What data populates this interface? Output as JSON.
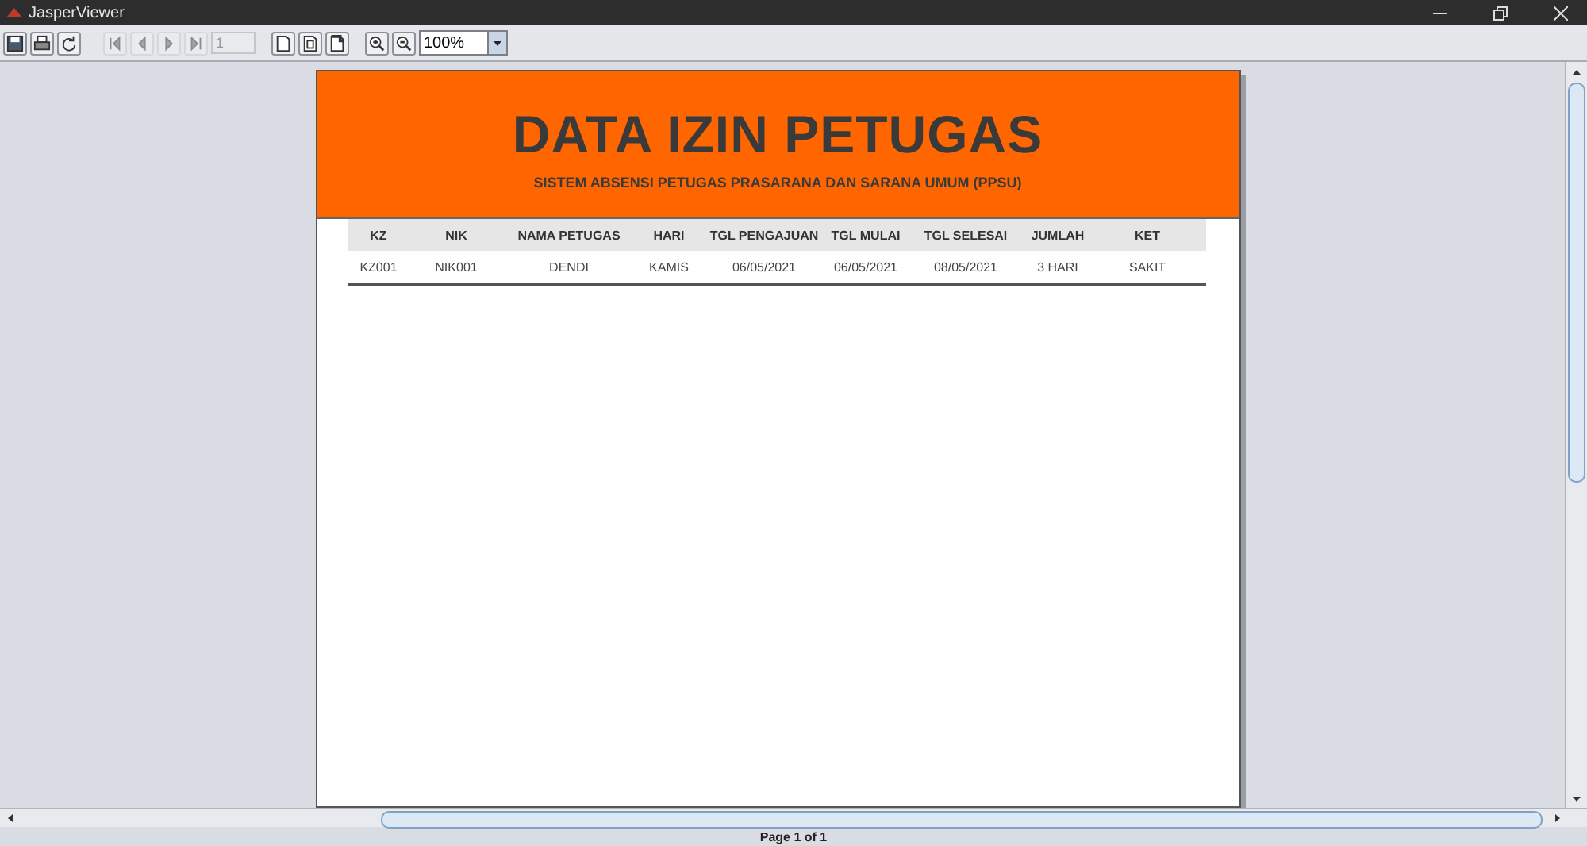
{
  "window": {
    "title": "JasperViewer"
  },
  "toolbar": {
    "buttons": [
      {
        "kind": "save",
        "disabled": false
      },
      {
        "kind": "print",
        "disabled": false
      },
      {
        "kind": "reload",
        "disabled": false
      },
      {
        "kind": "first",
        "disabled": true
      },
      {
        "kind": "previous",
        "disabled": true
      },
      {
        "kind": "next",
        "disabled": true
      },
      {
        "kind": "last",
        "disabled": true
      }
    ],
    "page_field": {
      "value": "1",
      "disabled": true
    },
    "view_buttons": [
      {
        "kind": "actual-size"
      },
      {
        "kind": "fit-page"
      },
      {
        "kind": "fit-width"
      },
      {
        "kind": "zoom-in"
      },
      {
        "kind": "zoom-out"
      }
    ],
    "zoom_combo": {
      "value": "100%"
    }
  },
  "report": {
    "title": "DATA IZIN PETUGAS",
    "subtitle": "SISTEM ABSENSI PETUGAS PRASARANA DAN SARANA UMUM (PPSU)",
    "columns": [
      "KZ",
      "NIK",
      "NAMA PETUGAS",
      "HARI",
      "TGL PENGAJUAN",
      "TGL MULAI",
      "TGL SELESAI",
      "JUMLAH",
      "KET"
    ],
    "rows": [
      [
        "KZ001",
        "NIK001",
        "DENDI",
        "KAMIS",
        "06/05/2021",
        "06/05/2021",
        "08/05/2021",
        "3 HARI",
        "SAKIT"
      ]
    ]
  },
  "status_bar": {
    "text": "Page 1 of 1"
  }
}
